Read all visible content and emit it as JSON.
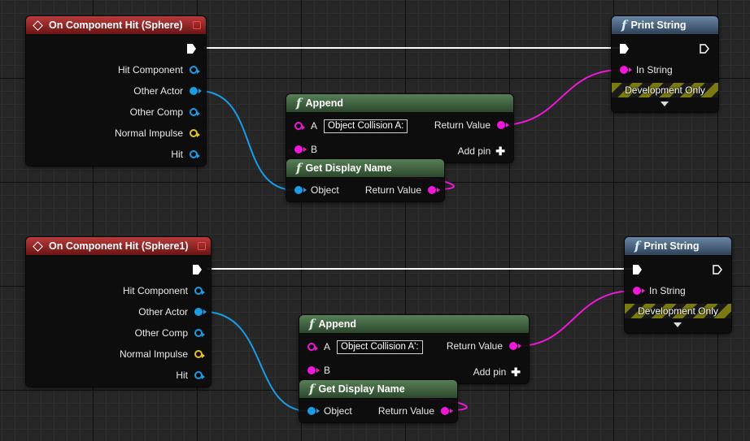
{
  "groups": [
    {
      "event": {
        "title": "On Component Hit (Sphere)",
        "pins": [
          "Hit Component",
          "Other Actor",
          "Other Comp",
          "Normal Impulse",
          "Hit"
        ]
      },
      "append": {
        "title": "Append",
        "a_label": "A",
        "a_value": "Object Collision A:",
        "b_label": "B",
        "return_label": "Return Value",
        "add_pin": "Add pin"
      },
      "get_display_name": {
        "title": "Get Display Name",
        "object_label": "Object",
        "return_label": "Return Value"
      },
      "print_string": {
        "title": "Print String",
        "in_string": "In String",
        "dev_only": "Development Only"
      }
    },
    {
      "event": {
        "title": "On Component Hit (Sphere1)",
        "pins": [
          "Hit Component",
          "Other Actor",
          "Other Comp",
          "Normal Impulse",
          "Hit"
        ]
      },
      "append": {
        "title": "Append",
        "a_label": "A",
        "a_value": "Object Collision A':",
        "b_label": "B",
        "return_label": "Return Value",
        "add_pin": "Add pin"
      },
      "get_display_name": {
        "title": "Get Display Name",
        "object_label": "Object",
        "return_label": "Return Value"
      },
      "print_string": {
        "title": "Print String",
        "in_string": "In String",
        "dev_only": "Development Only"
      }
    }
  ],
  "colors": {
    "exec_wire": "#ffffff",
    "object_wire": "#1a9be6",
    "string_wire": "#f018d8",
    "vector_pin": "#e5c21e",
    "event_header": "#8b2323",
    "function_header": "#3b5e3b",
    "print_header": "#3e5875"
  }
}
